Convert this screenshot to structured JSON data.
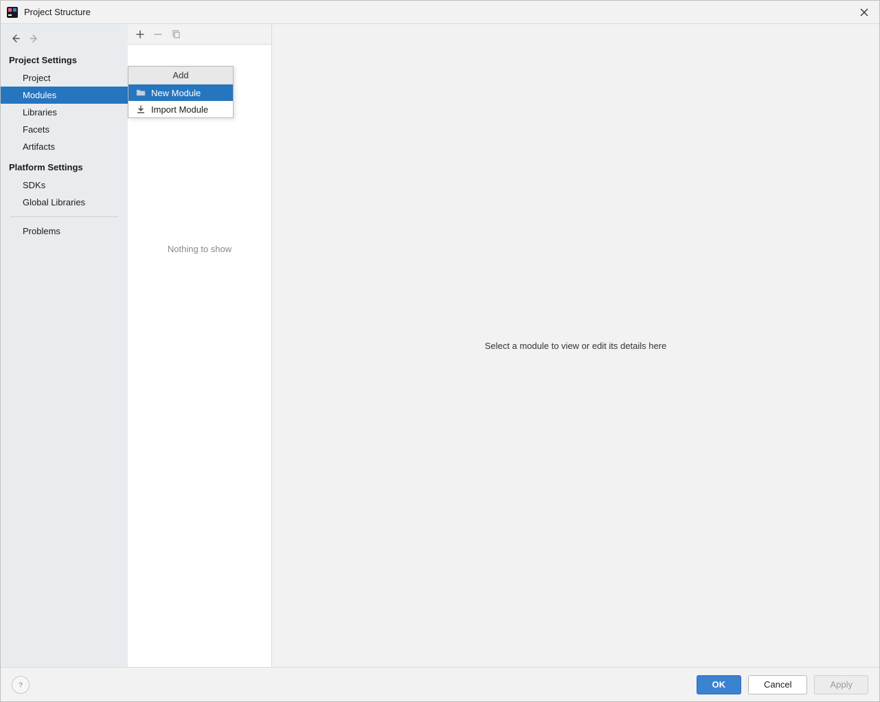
{
  "title": "Project Structure",
  "sidebar": {
    "sections": {
      "project_settings": {
        "header": "Project Settings",
        "items": [
          {
            "label": "Project"
          },
          {
            "label": "Modules"
          },
          {
            "label": "Libraries"
          },
          {
            "label": "Facets"
          },
          {
            "label": "Artifacts"
          }
        ]
      },
      "platform_settings": {
        "header": "Platform Settings",
        "items": [
          {
            "label": "SDKs"
          },
          {
            "label": "Global Libraries"
          }
        ]
      },
      "bottom": {
        "items": [
          {
            "label": "Problems"
          }
        ]
      }
    },
    "selected": "Modules"
  },
  "listpanel": {
    "empty_text": "Nothing to show"
  },
  "popup": {
    "header": "Add",
    "items": [
      {
        "label": "New Module"
      },
      {
        "label": "Import Module"
      }
    ],
    "selected": "New Module"
  },
  "detail": {
    "placeholder": "Select a module to view or edit its details here"
  },
  "buttons": {
    "ok": "OK",
    "cancel": "Cancel",
    "apply": "Apply"
  }
}
